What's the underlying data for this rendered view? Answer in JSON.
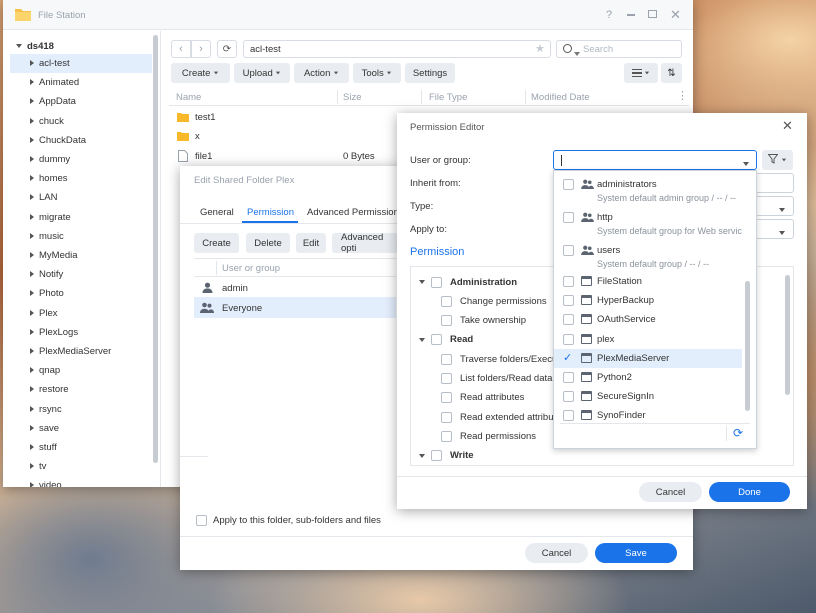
{
  "fs": {
    "title": "File Station",
    "help": "?",
    "server": "ds418",
    "folders": [
      "acl-test",
      "Animated",
      "AppData",
      "chuck",
      "ChuckData",
      "dummy",
      "homes",
      "LAN",
      "migrate",
      "music",
      "MyMedia",
      "Notify",
      "Photo",
      "Plex",
      "PlexLogs",
      "PlexMediaServer",
      "qnap",
      "restore",
      "rsync",
      "save",
      "stuff",
      "tv",
      "video"
    ],
    "path": "acl-test",
    "search_placeholder": "Search",
    "toolbar": {
      "create": "Create",
      "upload": "Upload",
      "action": "Action",
      "tools": "Tools",
      "settings": "Settings"
    },
    "columns": {
      "name": "Name",
      "size": "Size",
      "type": "File Type",
      "modified": "Modified Date"
    },
    "files": [
      {
        "name": "test1",
        "size": "",
        "kind": "folder"
      },
      {
        "name": "x",
        "size": "",
        "kind": "folder"
      },
      {
        "name": "file1",
        "size": "0 Bytes",
        "kind": "file"
      }
    ]
  },
  "esf": {
    "title": "Edit Shared Folder Plex",
    "tabs": [
      "General",
      "Permission",
      "Advanced Permissions"
    ],
    "buttons": {
      "create": "Create",
      "delete": "Delete",
      "edit": "Edit",
      "advanced": "Advanced opti"
    },
    "col_user": "User or group",
    "users": [
      {
        "name": "admin"
      },
      {
        "name": "Everyone"
      }
    ],
    "apply_label": "Apply to this folder, sub-folders and files",
    "cancel": "Cancel",
    "save": "Save"
  },
  "pe": {
    "title": "Permission Editor",
    "labels": {
      "user": "User or group:",
      "inherit": "Inherit from:",
      "type": "Type:",
      "apply": "Apply to:"
    },
    "section": "Permission",
    "tree": [
      {
        "label": "Administration",
        "level": 0
      },
      {
        "label": "Change permissions",
        "level": 1
      },
      {
        "label": "Take ownership",
        "level": 1
      },
      {
        "label": "Read",
        "level": 0
      },
      {
        "label": "Traverse folders/Execute",
        "level": 1
      },
      {
        "label": "List folders/Read data",
        "level": 1
      },
      {
        "label": "Read attributes",
        "level": 1
      },
      {
        "label": "Read extended attribute",
        "level": 1
      },
      {
        "label": "Read permissions",
        "level": 1
      },
      {
        "label": "Write",
        "level": 0
      }
    ],
    "cancel": "Cancel",
    "done": "Done"
  },
  "dropdown": {
    "groups": [
      {
        "name": "administrators",
        "desc": "System default admin group / -- / --"
      },
      {
        "name": "http",
        "desc": "System default group for Web servic..."
      },
      {
        "name": "users",
        "desc": "System default group / -- / --"
      }
    ],
    "apps": [
      {
        "name": "FileStation",
        "checked": false
      },
      {
        "name": "HyperBackup",
        "checked": false
      },
      {
        "name": "OAuthService",
        "checked": false
      },
      {
        "name": "plex",
        "checked": false
      },
      {
        "name": "PlexMediaServer",
        "checked": true
      },
      {
        "name": "Python2",
        "checked": false
      },
      {
        "name": "SecureSignIn",
        "checked": false
      },
      {
        "name": "SynoFinder",
        "checked": false
      }
    ]
  }
}
